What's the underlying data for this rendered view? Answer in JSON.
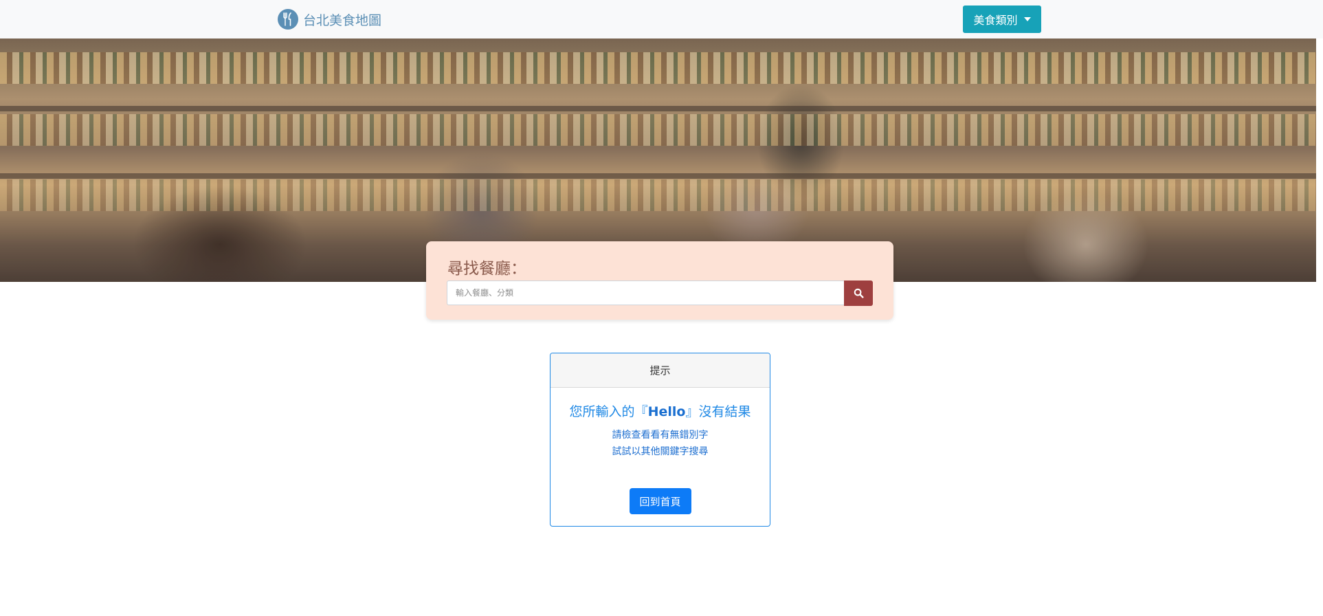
{
  "navbar": {
    "brand": "台北美食地圖",
    "brand_icon": "utensils-icon",
    "dropdown_label": "美食類別"
  },
  "search": {
    "title": "尋找餐廳：",
    "placeholder": "輸入餐廳、分類",
    "button_icon": "search-icon"
  },
  "card": {
    "header": "提示",
    "title_prefix": "您所輸入的『",
    "keyword": "Hello",
    "title_suffix": "』沒有結果",
    "hints": [
      "請檢查看看有無錯別字",
      "試試以其他關鍵字搜尋"
    ],
    "home_button": "回到首頁"
  },
  "colors": {
    "navbar_bg": "#f8f9fa",
    "brand": "#5b8fb5",
    "dropdown_bg": "#17a2b8",
    "search_panel_bg": "#fde2d6",
    "search_btn_bg": "#9e3f3f",
    "card_border": "#1e88e5",
    "home_btn_bg": "#0d7bf7"
  }
}
